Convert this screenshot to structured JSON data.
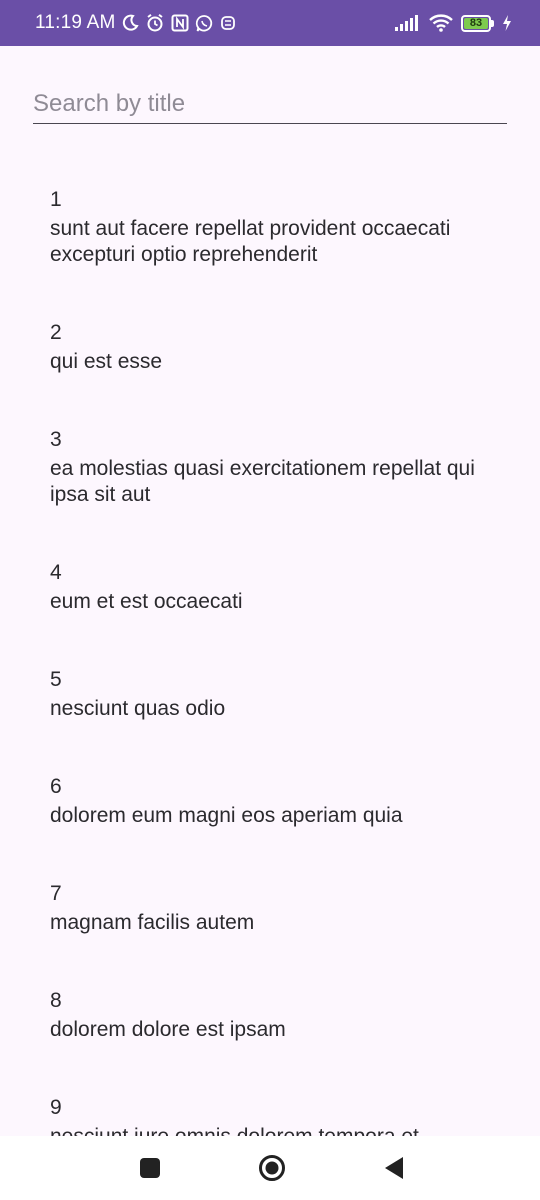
{
  "status_bar": {
    "time": "11:19 AM",
    "battery_level": "83",
    "icons": [
      "moon-icon",
      "alarm-icon",
      "nfc-icon",
      "whatsapp-icon",
      "sim-icon",
      "signal-icon",
      "wifi-icon",
      "battery-icon",
      "charging-icon"
    ],
    "background_color": "#6a4fa7",
    "battery_fill_color": "#7ecb4e"
  },
  "search": {
    "placeholder": "Search by title",
    "value": ""
  },
  "posts": [
    {
      "id": "1",
      "title": "sunt aut facere repellat provident occaecati excepturi optio reprehenderit"
    },
    {
      "id": "2",
      "title": "qui est esse"
    },
    {
      "id": "3",
      "title": "ea molestias quasi exercitationem repellat qui ipsa sit aut"
    },
    {
      "id": "4",
      "title": "eum et est occaecati"
    },
    {
      "id": "5",
      "title": "nesciunt quas odio"
    },
    {
      "id": "6",
      "title": "dolorem eum magni eos aperiam quia"
    },
    {
      "id": "7",
      "title": "magnam facilis autem"
    },
    {
      "id": "8",
      "title": "dolorem dolore est ipsam"
    },
    {
      "id": "9",
      "title": "nesciunt iure omnis dolorem tempora et accusantium"
    }
  ],
  "nav_bar": {
    "buttons": [
      "recents-button",
      "home-button",
      "back-button"
    ]
  },
  "colors": {
    "page_background": "#fdf7fe",
    "text": "#2b2a2e"
  }
}
